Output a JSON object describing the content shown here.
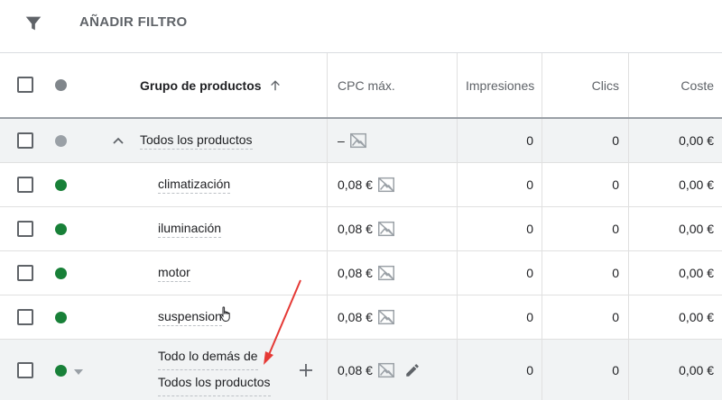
{
  "filter": {
    "label": "AÑADIR FILTRO",
    "icon": "filter-icon"
  },
  "columns": {
    "product_group": "Grupo de productos",
    "max_cpc": "CPC máx.",
    "impressions": "Impresiones",
    "clicks": "Clics",
    "cost": "Coste"
  },
  "colors": {
    "active": "#188038",
    "inactive": "#9aa0a6",
    "annotation": "#e53935"
  },
  "total": {
    "name": "Todos los productos",
    "cpc": "–",
    "impressions": "0",
    "clicks": "0",
    "cost": "0,00 €"
  },
  "rows": [
    {
      "name": "climatización",
      "cpc": "0,08 €",
      "impressions": "0",
      "clicks": "0",
      "cost": "0,00 €"
    },
    {
      "name": "iluminación",
      "cpc": "0,08 €",
      "impressions": "0",
      "clicks": "0",
      "cost": "0,00 €"
    },
    {
      "name": "motor",
      "cpc": "0,08 €",
      "impressions": "0",
      "clicks": "0",
      "cost": "0,00 €"
    },
    {
      "name": "suspension",
      "cpc": "0,08 €",
      "impressions": "0",
      "clicks": "0",
      "cost": "0,00 €"
    }
  ],
  "last": {
    "name_line1": "Todo lo demás de",
    "name_line2": "Todos los productos",
    "cpc": "0,08 €",
    "impressions": "0",
    "clicks": "0",
    "cost": "0,00 €"
  }
}
